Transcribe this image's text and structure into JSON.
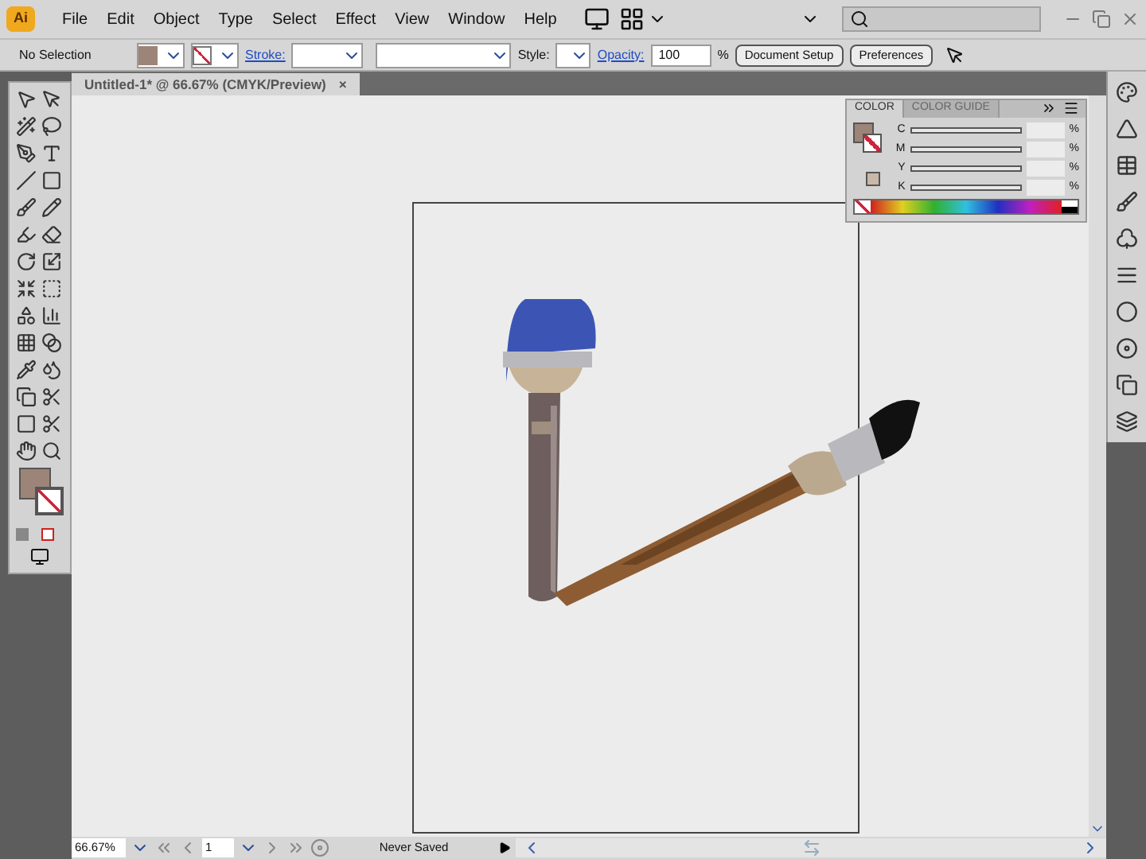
{
  "app_badge": "Ai",
  "menu": [
    "File",
    "Edit",
    "Object",
    "Type",
    "Select",
    "Effect",
    "View",
    "Window",
    "Help"
  ],
  "control_bar": {
    "selection": "No Selection",
    "stroke_label": "Stroke:",
    "style_label": "Style:",
    "opacity_label": "Opacity:",
    "opacity_value": "100",
    "percent": "%",
    "buttons": [
      "Document Setup",
      "Preferences"
    ]
  },
  "document_tab": {
    "title": "Untitled-1* @ 66.67% (CMYK/Preview)",
    "close": "×"
  },
  "color_panel": {
    "tabs": [
      {
        "label": "COLOR",
        "selected": true
      },
      {
        "label": "COLOR GUIDE",
        "selected": false
      }
    ],
    "channels": [
      {
        "name": "C",
        "unit": "%"
      },
      {
        "name": "M",
        "unit": "%"
      },
      {
        "name": "Y",
        "unit": "%"
      },
      {
        "name": "K",
        "unit": "%"
      }
    ]
  },
  "status_bar": {
    "zoom": "66.67%",
    "page": "1",
    "status": "Never Saved"
  }
}
